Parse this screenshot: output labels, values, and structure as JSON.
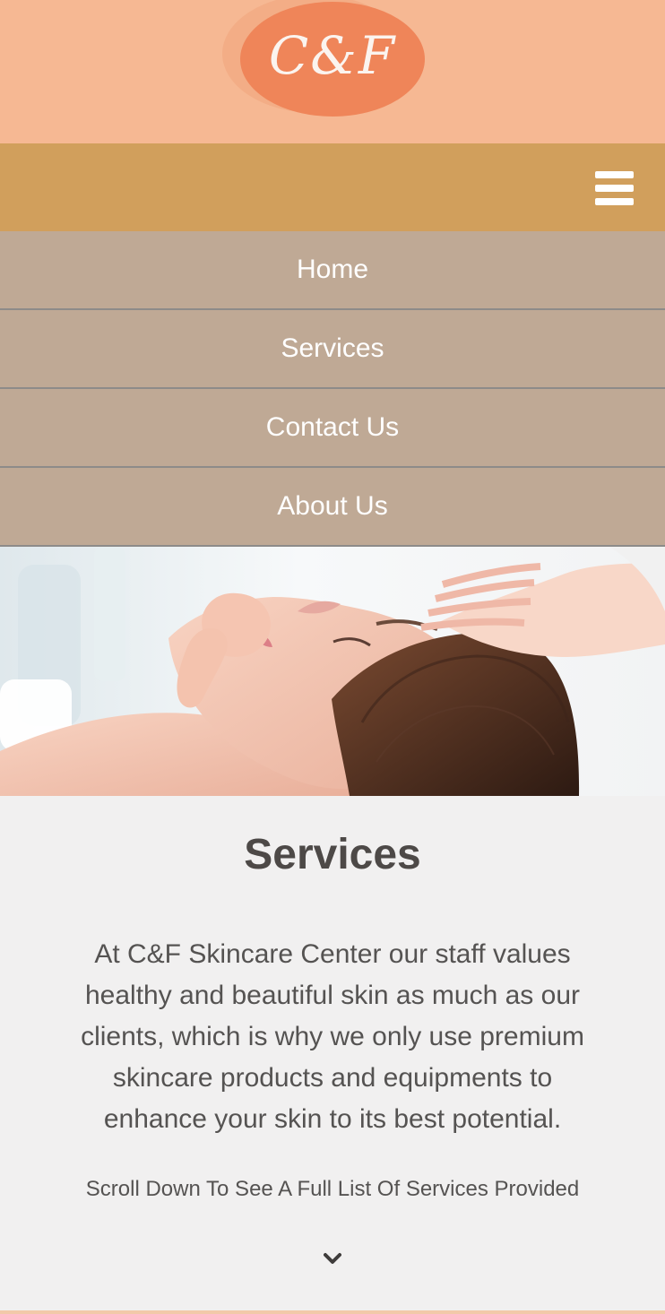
{
  "header": {
    "logo_text": "C&F"
  },
  "nav": {
    "menu_icon": "hamburger-menu-icon",
    "items": [
      {
        "label": "Home"
      },
      {
        "label": "Services"
      },
      {
        "label": "Contact Us"
      },
      {
        "label": "About Us"
      }
    ]
  },
  "main": {
    "title": "Services",
    "description": "At C&F Skincare Center our staff values healthy and beautiful skin as much as our clients, which is why we only use premium skincare products and equipments to enhance your skin to its best potential.",
    "scroll_hint": "Scroll Down To See A Full List Of Services Provided",
    "scroll_icon": "chevron-down-icon"
  },
  "colors": {
    "header_bg": "#f6b893",
    "logo_bg": "#ef8559",
    "nav_bg": "#d19f5c",
    "menu_bg": "#bfa995",
    "content_bg": "#f1f0f0",
    "title_text": "#4d4947"
  }
}
